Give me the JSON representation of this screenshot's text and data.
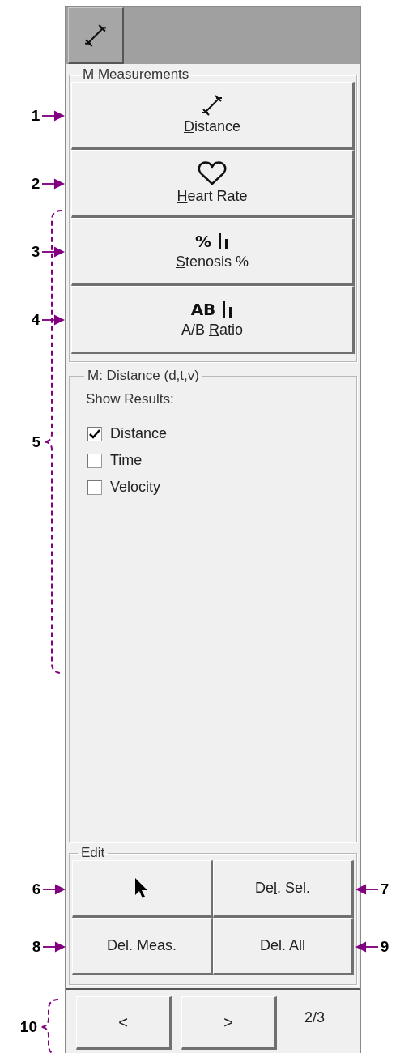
{
  "tool_tab": {
    "kind": "caliper"
  },
  "measurements": {
    "title": "M Measurements",
    "buttons": [
      {
        "icon": {
          "kind": "caliper"
        },
        "label": [
          {
            "text": "D",
            "underlined": true
          },
          {
            "text": "istance",
            "underlined": false
          }
        ],
        "callout": "1"
      },
      {
        "icon": {
          "kind": "heart"
        },
        "label": [
          {
            "text": "H",
            "underlined": true
          },
          {
            "text": "eart Rate",
            "underlined": false
          }
        ],
        "callout": "2"
      },
      {
        "icon": {
          "kind": "text_bars",
          "text": "%"
        },
        "label": [
          {
            "text": "S",
            "underlined": true
          },
          {
            "text": "tenosis %",
            "underlined": false
          }
        ],
        "callout": "3"
      },
      {
        "icon": {
          "kind": "text_bars",
          "text": "AB"
        },
        "label": [
          {
            "text": "A/B ",
            "underlined": false
          },
          {
            "text": "R",
            "underlined": true
          },
          {
            "text": "atio",
            "underlined": false
          }
        ],
        "callout": "4"
      }
    ]
  },
  "options": {
    "title": "M: Distance (d,t,v)",
    "heading": "Show Results:",
    "callout": "5",
    "checkboxes": [
      {
        "label": "Distance",
        "checked": true
      },
      {
        "label": "Time",
        "checked": false
      },
      {
        "label": "Velocity",
        "checked": false
      }
    ]
  },
  "edit": {
    "title": "Edit",
    "buttons": [
      {
        "kind": "pointer",
        "callout": "6"
      },
      {
        "kind": "text",
        "label": [
          {
            "text": "De",
            "underlined": false
          },
          {
            "text": "l",
            "underlined": true
          },
          {
            "text": ". Sel.",
            "underlined": false
          }
        ],
        "callout": "7"
      },
      {
        "kind": "text",
        "label": [
          {
            "text": "Del. Meas.",
            "underlined": false
          }
        ],
        "callout": "8"
      },
      {
        "kind": "text",
        "label": [
          {
            "text": "Del. All",
            "underlined": false
          }
        ],
        "callout": "9"
      }
    ]
  },
  "nav": {
    "buttons": [
      "<",
      ">"
    ],
    "page": "2/3",
    "callout": "10"
  }
}
